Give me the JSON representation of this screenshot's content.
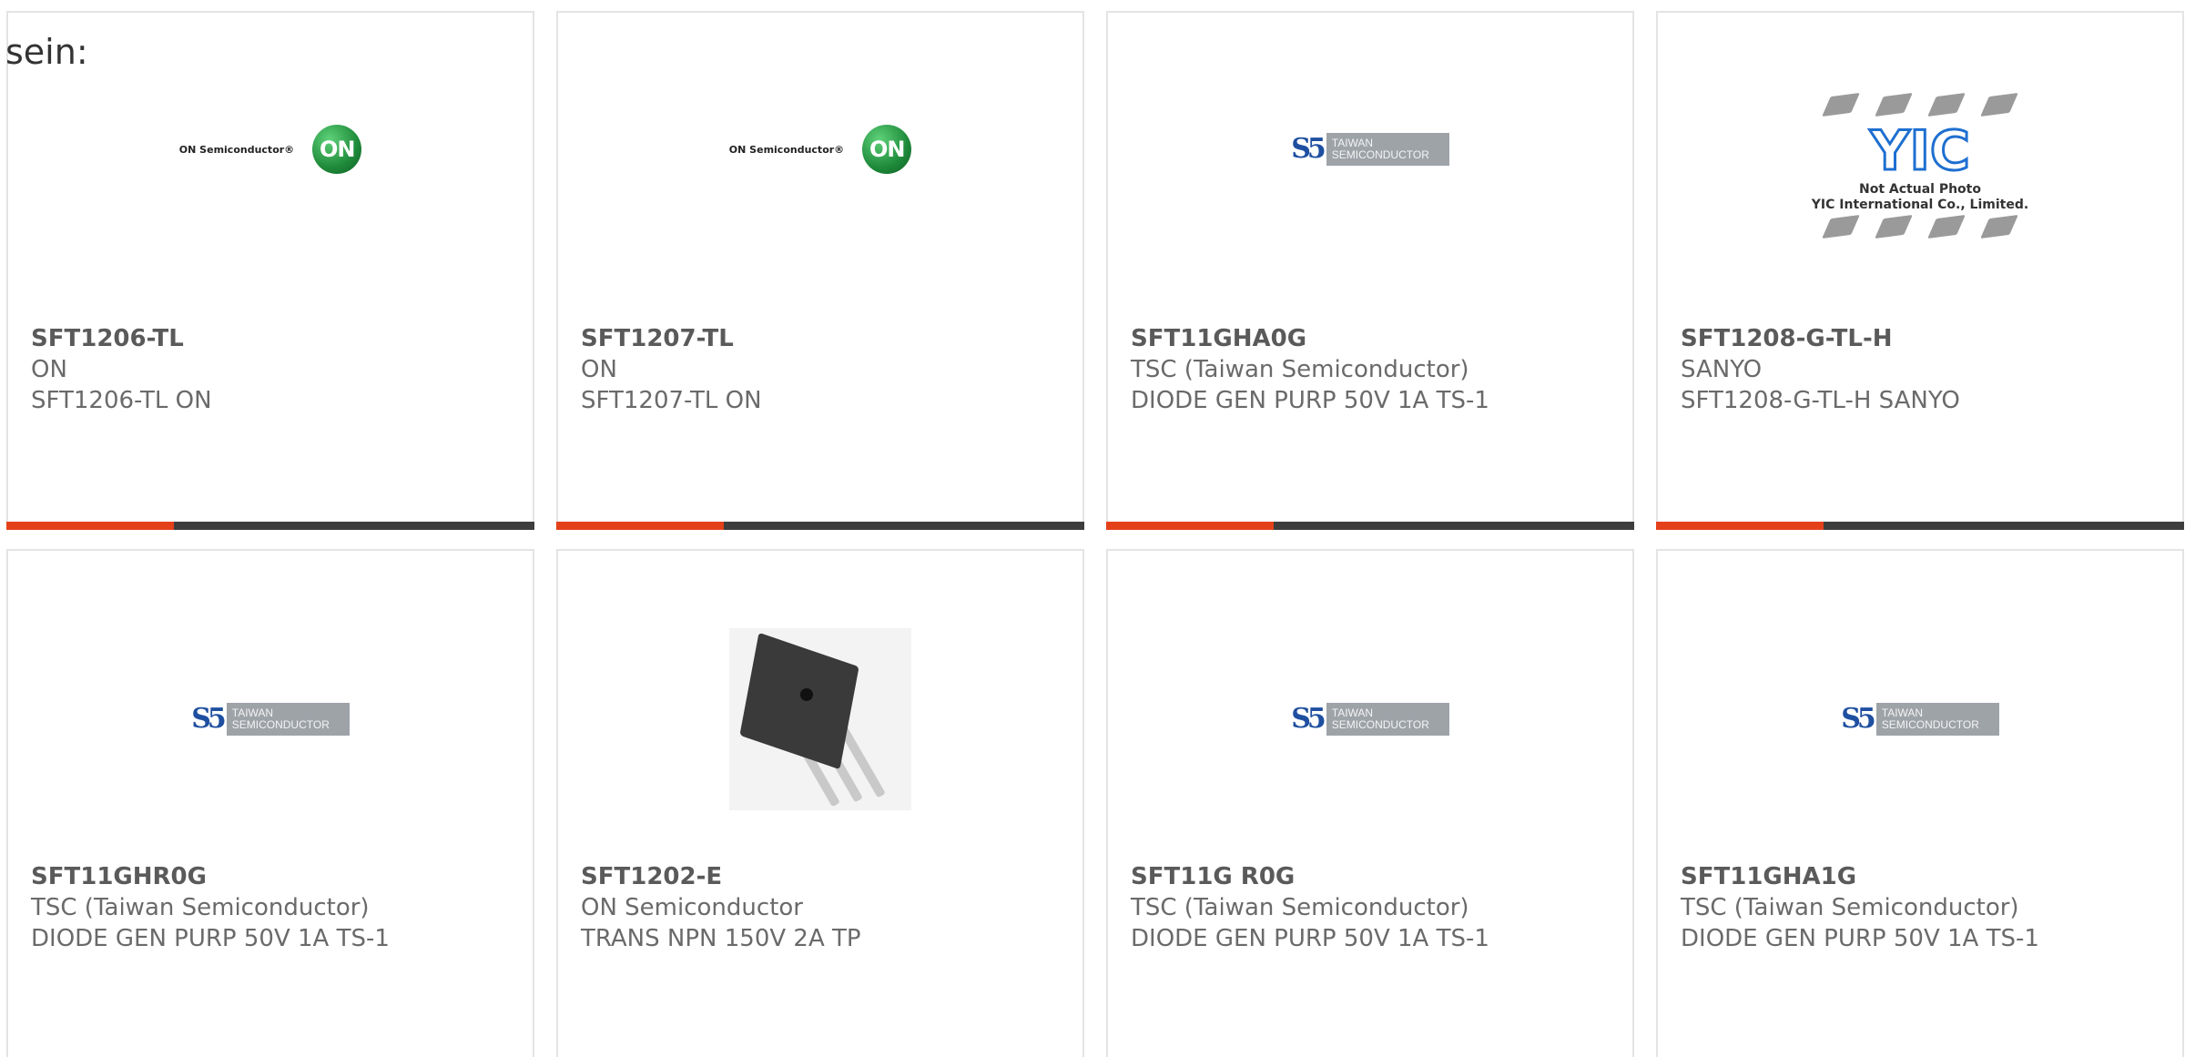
{
  "intro_text": "sein:",
  "accent_color": "#e4411b",
  "bar_color": "#3d3d3d",
  "products": [
    {
      "part": "SFT1206-TL",
      "manufacturer": "ON",
      "description": "SFT1206-TL ON",
      "image": "on-semiconductor-logo",
      "logo_text": "ON Semiconductor®",
      "badge": "ON"
    },
    {
      "part": "SFT1207-TL",
      "manufacturer": "ON",
      "description": "SFT1207-TL ON",
      "image": "on-semiconductor-logo",
      "logo_text": "ON Semiconductor®",
      "badge": "ON"
    },
    {
      "part": "SFT11GHA0G",
      "manufacturer": "TSC (Taiwan Semiconductor)",
      "description": "DIODE GEN PURP 50V 1A TS-1",
      "image": "taiwan-semiconductor-logo",
      "logo_line1": "TAIWAN",
      "logo_line2": "SEMICONDUCTOR"
    },
    {
      "part": "SFT1208-G-TL-H",
      "manufacturer": "SANYO",
      "description": "SFT1208-G-TL-H SANYO",
      "image": "yic-placeholder",
      "caption1": "Not Actual Photo",
      "caption2": "YIC International Co., Limited.",
      "mark": "YIC"
    },
    {
      "part": "SFT11GHR0G",
      "manufacturer": "TSC (Taiwan Semiconductor)",
      "description": "DIODE GEN PURP 50V 1A TS-1",
      "image": "taiwan-semiconductor-logo",
      "logo_line1": "TAIWAN",
      "logo_line2": "SEMICONDUCTOR"
    },
    {
      "part": "SFT1202-E",
      "manufacturer": "ON Semiconductor",
      "description": "TRANS NPN 150V 2A TP",
      "image": "transistor-photo"
    },
    {
      "part": "SFT11G R0G",
      "manufacturer": "TSC (Taiwan Semiconductor)",
      "description": "DIODE GEN PURP 50V 1A TS-1",
      "image": "taiwan-semiconductor-logo",
      "logo_line1": "TAIWAN",
      "logo_line2": "SEMICONDUCTOR"
    },
    {
      "part": "SFT11GHA1G",
      "manufacturer": "TSC (Taiwan Semiconductor)",
      "description": "DIODE GEN PURP 50V 1A TS-1",
      "image": "taiwan-semiconductor-logo",
      "logo_line1": "TAIWAN",
      "logo_line2": "SEMICONDUCTOR"
    }
  ]
}
